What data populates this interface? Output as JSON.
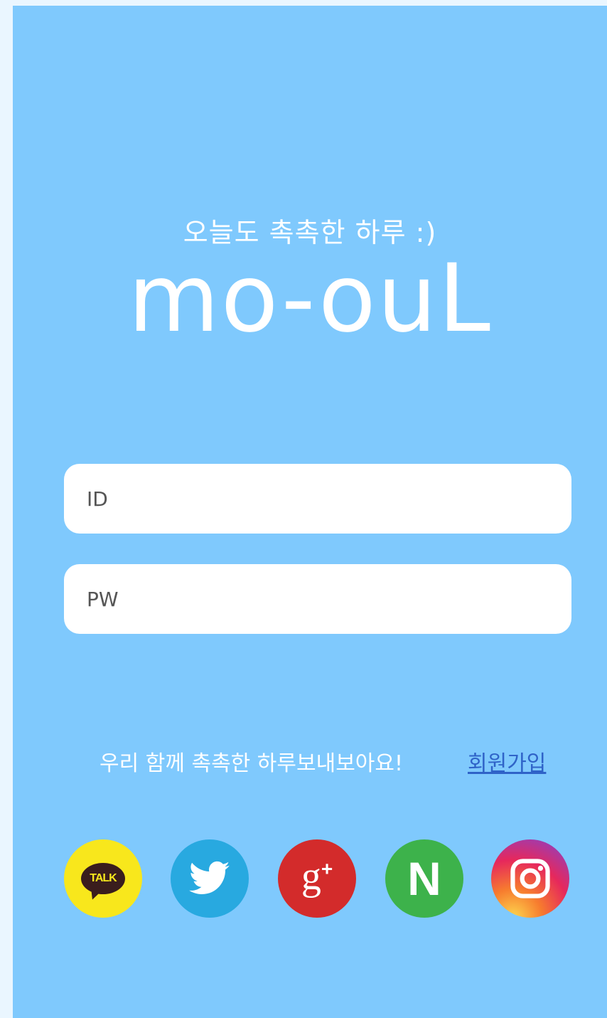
{
  "header": {
    "tagline": "오늘도 촉촉한 하루 :)",
    "brand": "mo-ouL"
  },
  "login": {
    "id_placeholder": "ID",
    "pw_placeholder": "PW"
  },
  "signup": {
    "message": "우리 함께 촉촉한 하루보내보아요!",
    "link_label": "회원가입"
  },
  "social": {
    "kakao": {
      "label": "TALK",
      "color": "#f8e71c"
    },
    "twitter": {
      "color": "#28a9e0"
    },
    "google": {
      "label": "g",
      "plus": "+",
      "color": "#d32b2b"
    },
    "naver": {
      "label": "N",
      "color": "#3db24b"
    },
    "instagram": {
      "color": "#e6285c"
    }
  },
  "colors": {
    "background": "#7fc9fd",
    "link": "#2f63c8"
  }
}
